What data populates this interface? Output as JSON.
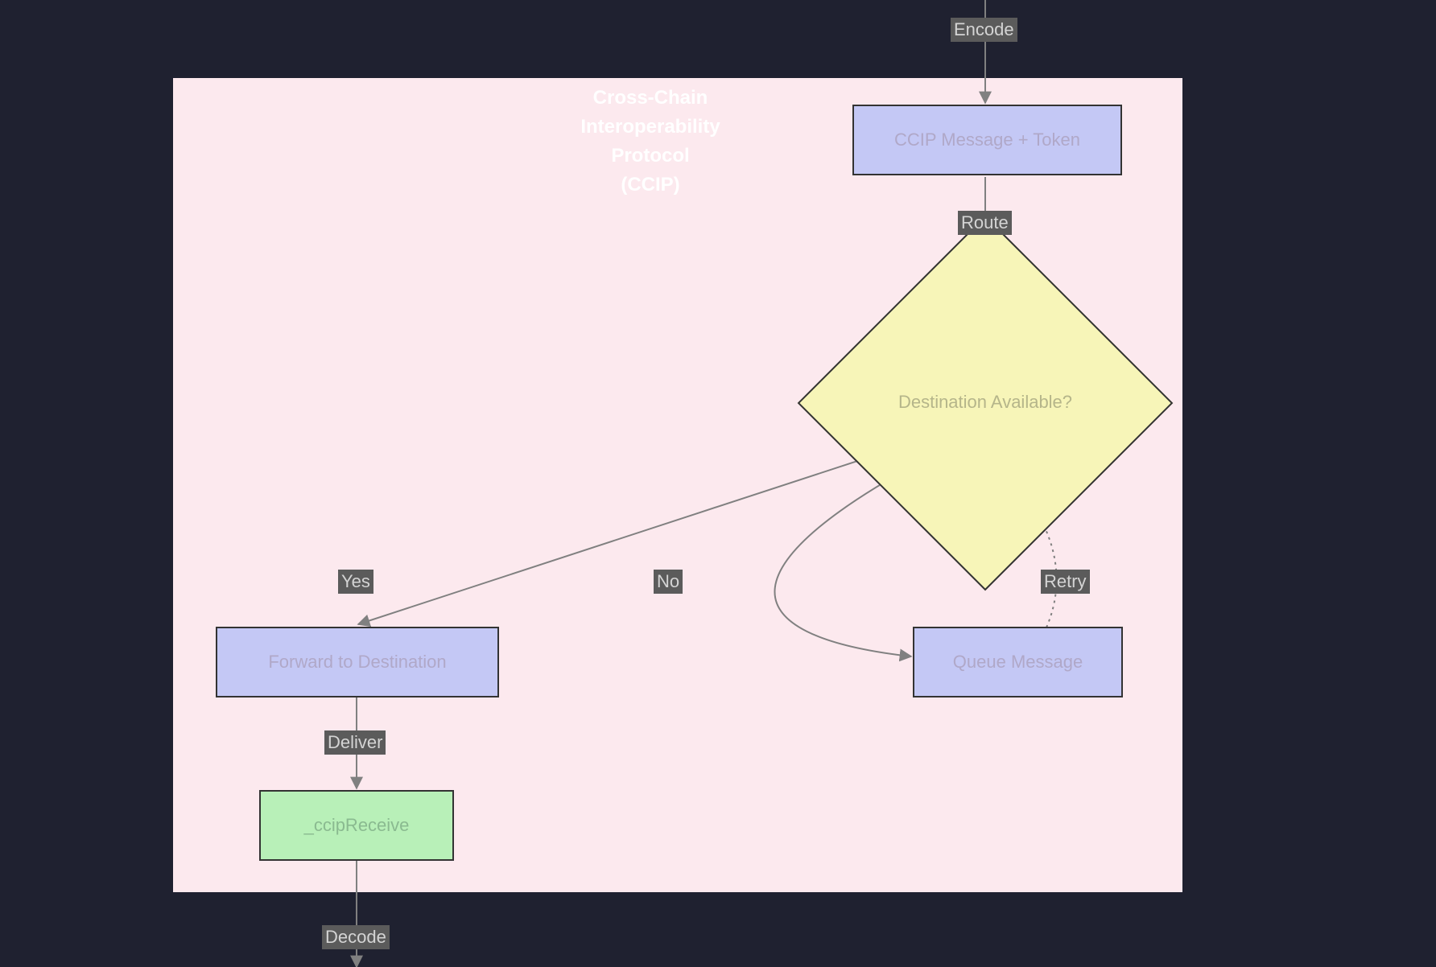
{
  "chart_data": {
    "type": "flowchart",
    "title": "Cross-Chain Interoperability Protocol (CCIP)",
    "nodes": [
      {
        "id": "ccip_msg",
        "label": "CCIP Message + Token",
        "shape": "process",
        "fill": "#c4c8f5"
      },
      {
        "id": "dest_avail",
        "label": "Destination Available?",
        "shape": "decision",
        "fill": "#f7f5b8"
      },
      {
        "id": "forward",
        "label": "Forward to Destination",
        "shape": "process",
        "fill": "#c4c8f5"
      },
      {
        "id": "queue",
        "label": "Queue Message",
        "shape": "process",
        "fill": "#c4c8f5"
      },
      {
        "id": "receive",
        "label": "_ccipReceive",
        "shape": "process",
        "fill": "#b8f0b8"
      }
    ],
    "edges": [
      {
        "from_external": true,
        "to": "ccip_msg",
        "label": "Encode"
      },
      {
        "from": "ccip_msg",
        "to": "dest_avail",
        "label": "Route"
      },
      {
        "from": "dest_avail",
        "to": "forward",
        "label": "Yes"
      },
      {
        "from": "dest_avail",
        "to": "queue",
        "label": "No"
      },
      {
        "from": "queue",
        "to": "dest_avail",
        "label": "Retry",
        "style": "dotted"
      },
      {
        "from": "forward",
        "to": "receive",
        "label": "Deliver"
      },
      {
        "from": "receive",
        "to_external": true,
        "label": "Decode"
      }
    ]
  },
  "title_lines": {
    "l1": "Cross-Chain",
    "l2": "Interoperability Protocol",
    "l3": "(CCIP)"
  },
  "nodes": {
    "ccip_msg": "CCIP Message + Token",
    "dest_avail": "Destination Available?",
    "forward": "Forward to Destination",
    "queue": "Queue Message",
    "receive": "_ccipReceive"
  },
  "edges": {
    "encode": "Encode",
    "route": "Route",
    "yes": "Yes",
    "no": "No",
    "retry": "Retry",
    "deliver": "Deliver",
    "decode": "Decode"
  }
}
